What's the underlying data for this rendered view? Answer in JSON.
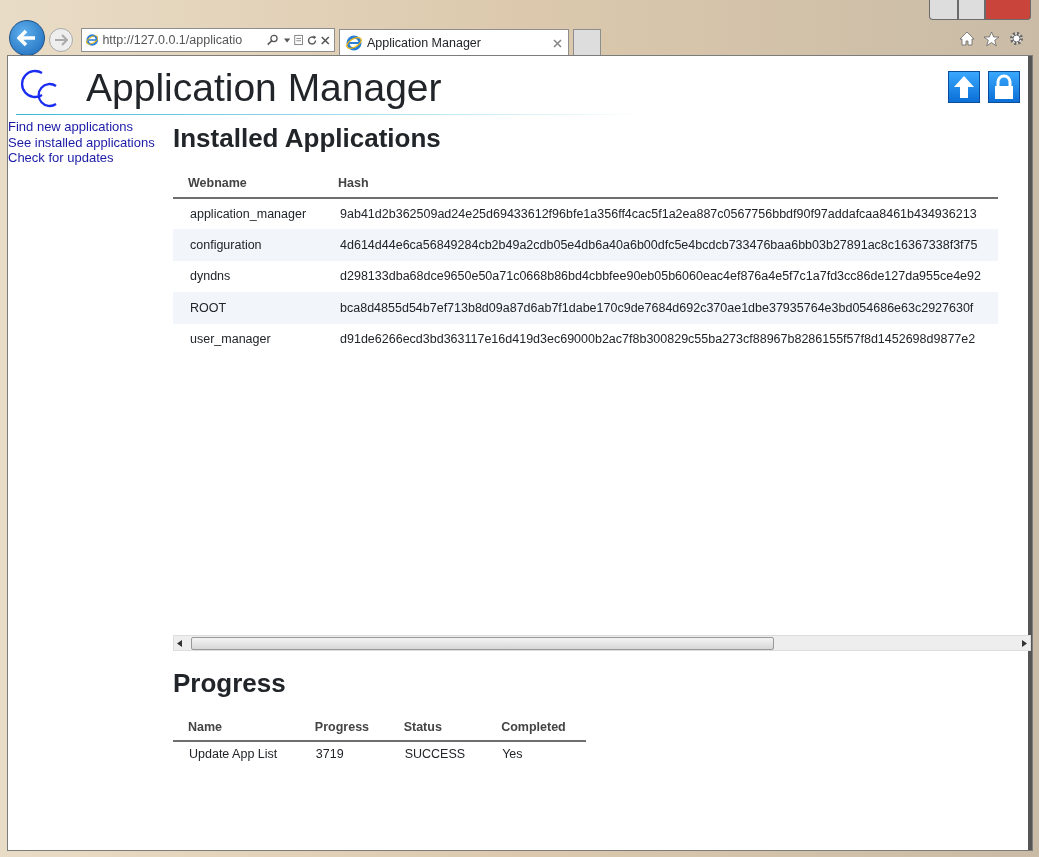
{
  "browser": {
    "address": "http://127.0.0.1/applicatio",
    "tabs": [
      {
        "label": "Application Manager",
        "selected": true
      }
    ]
  },
  "header": {
    "title": "Application Manager"
  },
  "sidebar": {
    "items": [
      "Find new applications",
      "See installed applications",
      "Check for updates"
    ]
  },
  "installed": {
    "title": "Installed Applications",
    "columns": [
      "Webname",
      "Hash"
    ],
    "rows": [
      [
        "application_manager",
        "9ab41d2b362509ad24e25d69433612f96bfe1a356ff4cac5f1a2ea887c0567756bbdf90f97addafcaa8461b434936213"
      ],
      [
        "configuration",
        "4d614d44e6ca56849284cb2b49a2cdb05e4db6a40a6b00dfc5e4bcdcb733476baa6bb03b27891ac8c16367338f3f75"
      ],
      [
        "dyndns",
        "d298133dba68dce9650e50a71c0668b86bd4cbbfee90eb05b6060eac4ef876a4e5f7c1a7fd3cc86de127da955ce4e92"
      ],
      [
        "ROOT",
        "bca8d4855d54b7ef713b8d09a87d6ab7f1dabe170c9de7684d692c370ae1dbe37935764e3bd054686e63c2927630f"
      ],
      [
        "user_manager",
        "d91de6266ecd3bd363117e16d419d3ec69000b2ac7f8b300829c55ba273cf88967b8286155f57f8d1452698d9877e2"
      ]
    ]
  },
  "progress": {
    "title": "Progress",
    "columns": [
      "Name",
      "Progress",
      "Status",
      "Completed"
    ],
    "rows": [
      [
        "Update App List",
        "3719",
        "SUCCESS",
        "Yes"
      ]
    ]
  }
}
